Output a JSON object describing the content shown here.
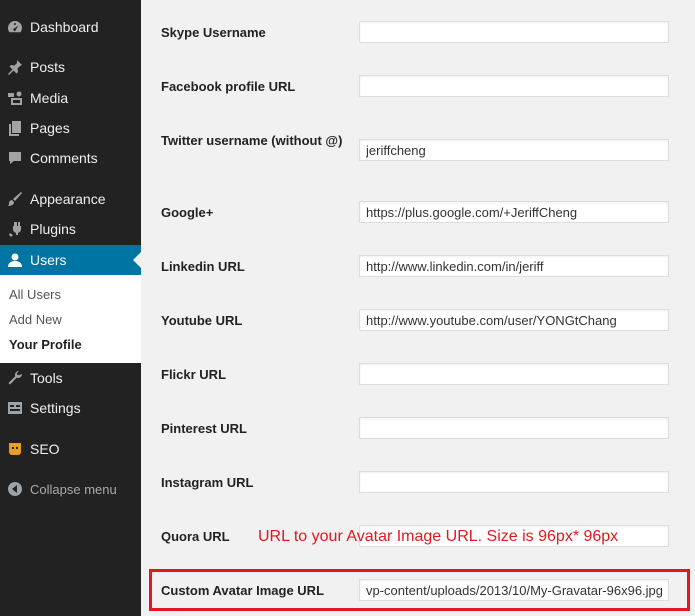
{
  "sidebar": {
    "items": [
      {
        "label": "Dashboard",
        "icon": "dashboard-icon"
      },
      {
        "label": "Posts",
        "icon": "pin-icon"
      },
      {
        "label": "Media",
        "icon": "media-icon"
      },
      {
        "label": "Pages",
        "icon": "pages-icon"
      },
      {
        "label": "Comments",
        "icon": "comment-icon"
      },
      {
        "label": "Appearance",
        "icon": "brush-icon"
      },
      {
        "label": "Plugins",
        "icon": "plug-icon"
      },
      {
        "label": "Users",
        "icon": "user-icon"
      },
      {
        "label": "Tools",
        "icon": "wrench-icon"
      },
      {
        "label": "Settings",
        "icon": "settings-icon"
      },
      {
        "label": "SEO",
        "icon": "seo-icon"
      }
    ],
    "submenu": [
      {
        "label": "All Users"
      },
      {
        "label": "Add New"
      },
      {
        "label": "Your Profile"
      }
    ],
    "collapse_label": "Collapse menu",
    "accent_color": "#0074a2"
  },
  "fields": [
    {
      "label": "Skype Username",
      "value": ""
    },
    {
      "label": "Facebook profile URL",
      "value": ""
    },
    {
      "label": "Twitter username (without @)",
      "value": "jeriffcheng"
    },
    {
      "label": "Google+",
      "value": "https://plus.google.com/+JeriffCheng"
    },
    {
      "label": "Linkedin URL",
      "value": "http://www.linkedin.com/in/jeriff"
    },
    {
      "label": "Youtube URL",
      "value": "http://www.youtube.com/user/YONGtChang"
    },
    {
      "label": "Flickr URL",
      "value": ""
    },
    {
      "label": "Pinterest URL",
      "value": ""
    },
    {
      "label": "Instagram URL",
      "value": ""
    },
    {
      "label": "Quora URL",
      "value": ""
    },
    {
      "label": "Custom Avatar Image URL",
      "value": "vp-content/uploads/2013/10/My-Gravatar-96x96.jpg"
    }
  ],
  "annotation": {
    "text": "URL to your Avatar Image URL. Size is 96px* 96px",
    "color": "#e0191f"
  }
}
